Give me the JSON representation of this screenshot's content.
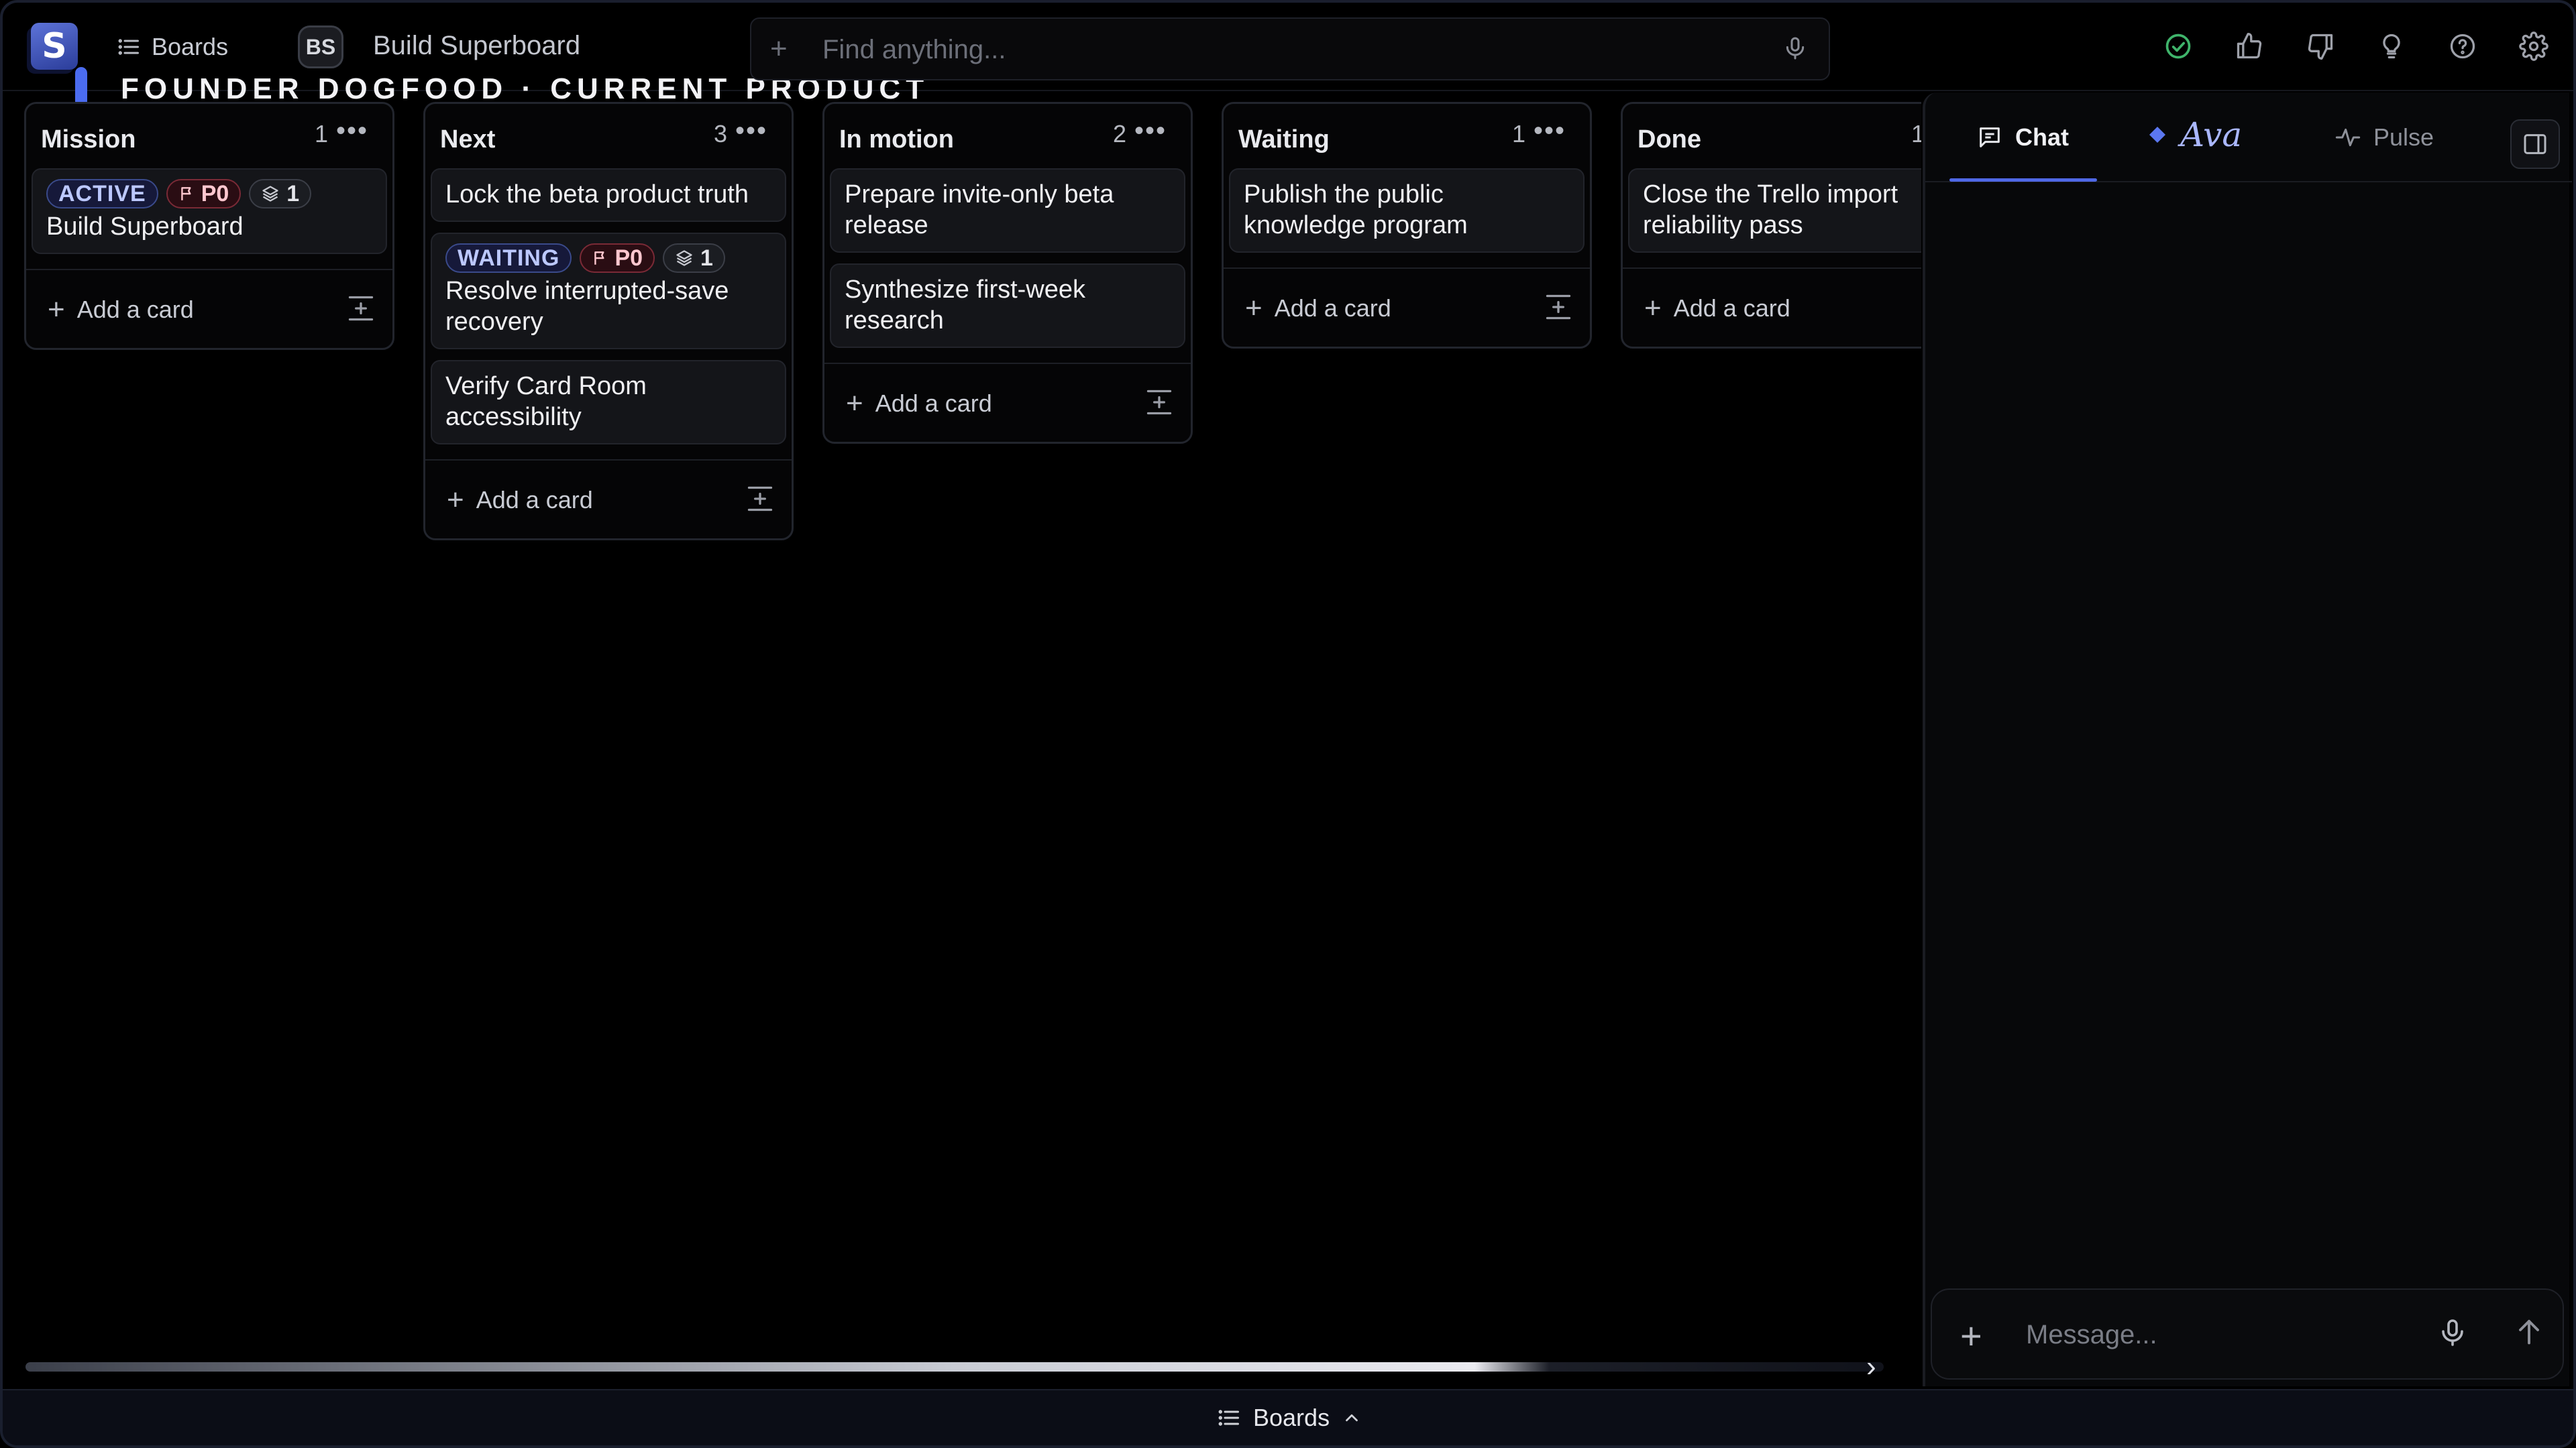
{
  "header": {
    "logo_letter": "S",
    "boards_label": "Boards",
    "board_initials": "BS",
    "board_name": "Build Superboard",
    "subtitle": "FOUNDER DOGFOOD · CURRENT PRODUCT",
    "search_placeholder": "Find anything...",
    "icons": [
      "check-circle-icon",
      "thumbs-up-icon",
      "thumbs-down-icon",
      "lightbulb-icon",
      "help-icon",
      "gear-icon"
    ]
  },
  "columns": [
    {
      "title": "Mission",
      "count": "1",
      "cards": [
        {
          "status": "ACTIVE",
          "priority": "P0",
          "layers": "1",
          "title": "Build Superboard"
        }
      ],
      "add_label": "Add a card"
    },
    {
      "title": "Next",
      "count": "3",
      "cards": [
        {
          "title": "Lock the beta product truth"
        },
        {
          "status": "WAITING",
          "priority": "P0",
          "layers": "1",
          "title": "Resolve interrupted-save recovery"
        },
        {
          "title": "Verify Card Room accessibility"
        }
      ],
      "add_label": "Add a card"
    },
    {
      "title": "In motion",
      "count": "2",
      "cards": [
        {
          "title": "Prepare invite-only beta release"
        },
        {
          "title": "Synthesize first-week research"
        }
      ],
      "add_label": "Add a card"
    },
    {
      "title": "Waiting",
      "count": "1",
      "cards": [
        {
          "title": "Publish the public knowledge program"
        }
      ],
      "add_label": "Add a card"
    },
    {
      "title": "Done",
      "count": "1",
      "cards": [
        {
          "title": "Close the Trello import reliability pass"
        }
      ],
      "add_label": "Add a card"
    }
  ],
  "panel": {
    "tabs": {
      "chat": "Chat",
      "ava": "Ava",
      "pulse": "Pulse"
    },
    "active_tab": "Chat",
    "message_placeholder": "Message..."
  },
  "footer": {
    "boards_label": "Boards"
  },
  "colors": {
    "accent": "#4f68e6",
    "background": "#000000",
    "success": "#3fb46b",
    "priority": "#7a2a36"
  }
}
